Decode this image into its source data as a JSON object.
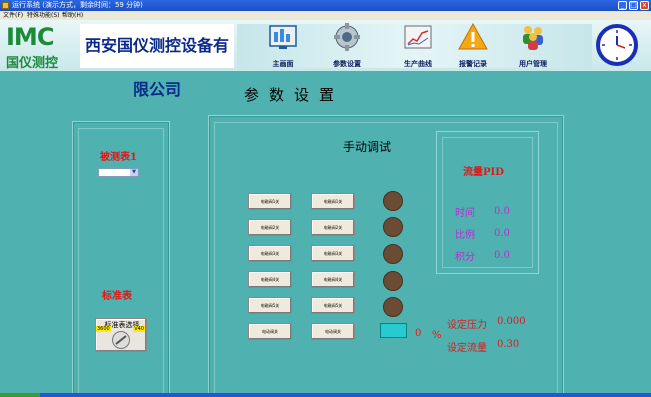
{
  "window": {
    "title": "运行系统 (演示方式，剩余时间：59 分钟)",
    "min_label": "_",
    "max_label": "□",
    "close_label": "x"
  },
  "menu": [
    {
      "label": "文件(F)"
    },
    {
      "label": "特殊功能(S)"
    },
    {
      "label": "帮助(H)"
    }
  ],
  "header": {
    "logo_main": "IMC",
    "logo_sub": "国仪测控",
    "company": "西安国仪测控设备有限公司",
    "nav": [
      {
        "label": "主画面",
        "icon": "monitor-icon"
      },
      {
        "label": "参数设置",
        "icon": "gear-icon"
      },
      {
        "label": "生产曲线",
        "icon": "chart-icon"
      },
      {
        "label": "报警记录",
        "icon": "warning-icon"
      },
      {
        "label": "用户管理",
        "icon": "users-icon"
      }
    ],
    "clock_icon": "clock-icon"
  },
  "page": {
    "title": "参数设置"
  },
  "left_panel": {
    "meter_label": "被测表1",
    "select_value": "",
    "standard_label": "标准表",
    "standard_button": "标准表选择",
    "tag_left": "3600",
    "tag_right": "V40"
  },
  "manual": {
    "title": "手动调试",
    "valves_left": [
      "电磁阀1关",
      "电磁阀2关",
      "电磁阀3关",
      "电磁阀4关",
      "电磁阀5关",
      "电动阀关"
    ],
    "valves_right": [
      "电磁阀1关",
      "电磁阀2关",
      "电磁阀3关",
      "电磁阀4关",
      "电磁阀5关",
      "电动阀关"
    ],
    "meter_value": "0",
    "meter_unit": "%",
    "set_pressure_label": "设定压力",
    "set_pressure_value": "0.000",
    "set_flow_label": "设定流量",
    "set_flow_value": "0.30"
  },
  "pid": {
    "title": "流量PID",
    "rows": [
      {
        "label": "时间",
        "value": "0.0"
      },
      {
        "label": "比例",
        "value": "0.0"
      },
      {
        "label": "积分",
        "value": "0.0"
      }
    ]
  },
  "colors": {
    "accent_red": "#e01818",
    "pid_purple": "#b330d0",
    "background": "#4fb2b0"
  }
}
